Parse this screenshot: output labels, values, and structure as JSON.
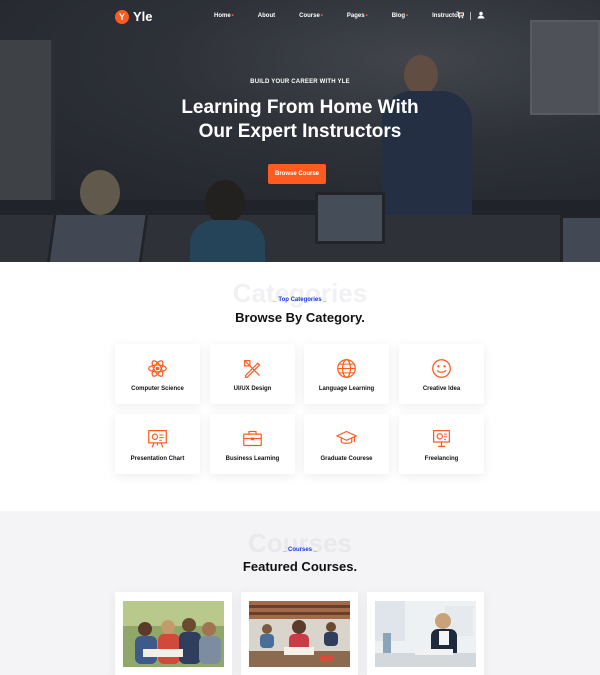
{
  "brand": {
    "logo_mark": "Y",
    "name": "Yle",
    "accent": "#ff5a1f",
    "link_color": "#1a3bd8"
  },
  "nav": {
    "items": [
      {
        "label": "Home",
        "has_dropdown": true
      },
      {
        "label": "About",
        "has_dropdown": false
      },
      {
        "label": "Course",
        "has_dropdown": true
      },
      {
        "label": "Pages",
        "has_dropdown": true
      },
      {
        "label": "Blog",
        "has_dropdown": true
      },
      {
        "label": "Instructor",
        "has_dropdown": true
      }
    ],
    "dropdown_dot": "•",
    "icons": [
      "cart-icon",
      "user-icon"
    ]
  },
  "hero": {
    "kicker": "BUILD YOUR CAREER WITH YLE",
    "title_line1": "Learning From Home With",
    "title_line2": "Our Expert Instructors",
    "button": "Browse Course"
  },
  "categories": {
    "ghost": "Categories",
    "tag": "_ Top Categories _",
    "title": "Browse By Category.",
    "items": [
      {
        "label": "Computer Science",
        "icon": "atom-icon"
      },
      {
        "label": "UI/UX Design",
        "icon": "design-tools-icon"
      },
      {
        "label": "Language Learning",
        "icon": "globe-icon"
      },
      {
        "label": "Creative Idea",
        "icon": "smile-icon"
      },
      {
        "label": "Presentation Chart",
        "icon": "presentation-icon"
      },
      {
        "label": "Business Learning",
        "icon": "briefcase-icon"
      },
      {
        "label": "Graduate Courese",
        "icon": "graduation-cap-icon"
      },
      {
        "label": "Freelancing",
        "icon": "board-icon"
      }
    ]
  },
  "courses": {
    "ghost": "Courses",
    "tag": "_ Courses _",
    "title": "Featured Courses.",
    "cards": [
      {
        "image": "students-group-photo"
      },
      {
        "image": "library-students-photo"
      },
      {
        "image": "office-woman-photo"
      }
    ]
  }
}
